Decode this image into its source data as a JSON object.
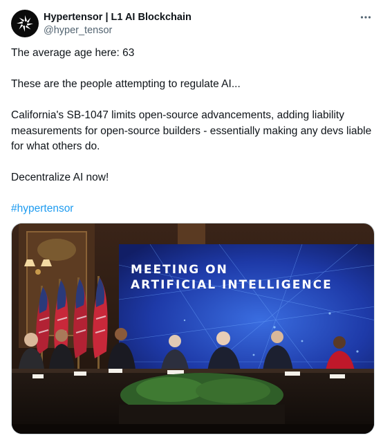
{
  "author": {
    "display_name": "Hypertensor | L1 AI Blockchain",
    "handle": "@hyper_tensor",
    "avatar_icon": "hypertensor-logo-icon"
  },
  "header": {
    "more_icon": "more-horizontal-icon"
  },
  "post": {
    "paragraphs": [
      "The average age here: 63",
      "These are the people attempting to regulate AI...",
      "California's SB-1047 limits open-source advancements, adding liability measurements for open-source builders - essentially making any devs liable for what others do.",
      "Decentralize AI now!"
    ],
    "hashtag": "#hypertensor"
  },
  "media": {
    "screen_text_line1": "MEETING ON",
    "screen_text_line2": "ARTIFICIAL INTELLIGENCE"
  },
  "colors": {
    "text": "#0f1419",
    "secondary_text": "#536471",
    "link": "#1d9bf0",
    "border": "#cfd9de",
    "screen_blue": "#1e3aa8"
  }
}
